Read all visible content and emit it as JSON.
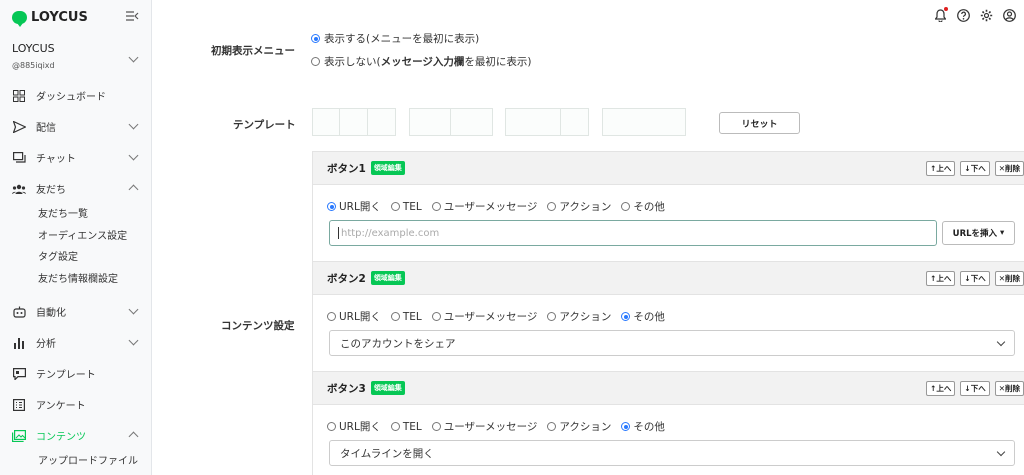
{
  "brand": {
    "name": "LOYCUS"
  },
  "account": {
    "name": "LOYCUS",
    "id": "@885iqixd"
  },
  "nav": {
    "dashboard": "ダッシュボード",
    "delivery": "配信",
    "chat": "チャット",
    "friends": "友だち",
    "friends_sub": [
      "友だち一覧",
      "オーディエンス設定",
      "タグ設定",
      "友だち情報欄設定"
    ],
    "automation": "自動化",
    "analysis": "分析",
    "template": "テンプレート",
    "survey": "アンケート",
    "contents": "コンテンツ",
    "upload": "アップロードファイル"
  },
  "form": {
    "initial_menu_label": "初期表示メニュー",
    "menu_opt_show": "表示する(メニューを最初に表示)",
    "menu_opt_hide_prefix": "表示しない(",
    "menu_opt_hide_bold": "メッセージ入力欄",
    "menu_opt_hide_suffix": "を最初に表示)",
    "template_label": "テンプレート",
    "reset_label": "リセット",
    "contents_label": "コンテンツ設定"
  },
  "action_types": [
    "URL開く",
    "TEL",
    "ユーザーメッセージ",
    "アクション",
    "その他"
  ],
  "panel_controls": {
    "up": "上へ",
    "down": "下へ",
    "delete": "削除"
  },
  "badge_label": "領域編集",
  "buttons": [
    {
      "title": "ボタン1",
      "selected": "URL開く",
      "url_placeholder": "http://example.com",
      "insert_label": "URLを挿入"
    },
    {
      "title": "ボタン2",
      "selected": "その他",
      "select_value": "このアカウントをシェア"
    },
    {
      "title": "ボタン3",
      "selected": "その他",
      "select_value": "タイムラインを開く"
    }
  ],
  "colors": {
    "brand": "#06c755",
    "radio": "#2979ff",
    "notification_dot": "#e02020"
  }
}
